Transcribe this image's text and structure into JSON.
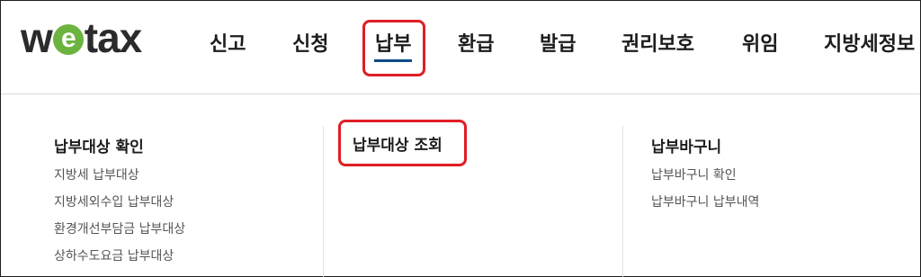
{
  "logo": {
    "left": "w",
    "e": "e",
    "right": "tax"
  },
  "nav": [
    "신고",
    "신청",
    "납부",
    "환급",
    "발급",
    "권리보호",
    "위임",
    "지방세정보"
  ],
  "menu": {
    "col1": {
      "title": "납부대상 확인",
      "items": [
        "지방세 납부대상",
        "지방세외수입 납부대상",
        "환경개선부담금 납부대상",
        "상하수도요금 납부대상"
      ]
    },
    "col2": {
      "title": "납부대상 조회"
    },
    "col3": {
      "title": "납부바구니",
      "items": [
        "납부바구니 확인",
        "납부바구니 납부내역"
      ]
    }
  },
  "colors": {
    "highlight": "#e01e25",
    "underline": "#0d4a8a",
    "logo_e": "#6cb33f"
  }
}
